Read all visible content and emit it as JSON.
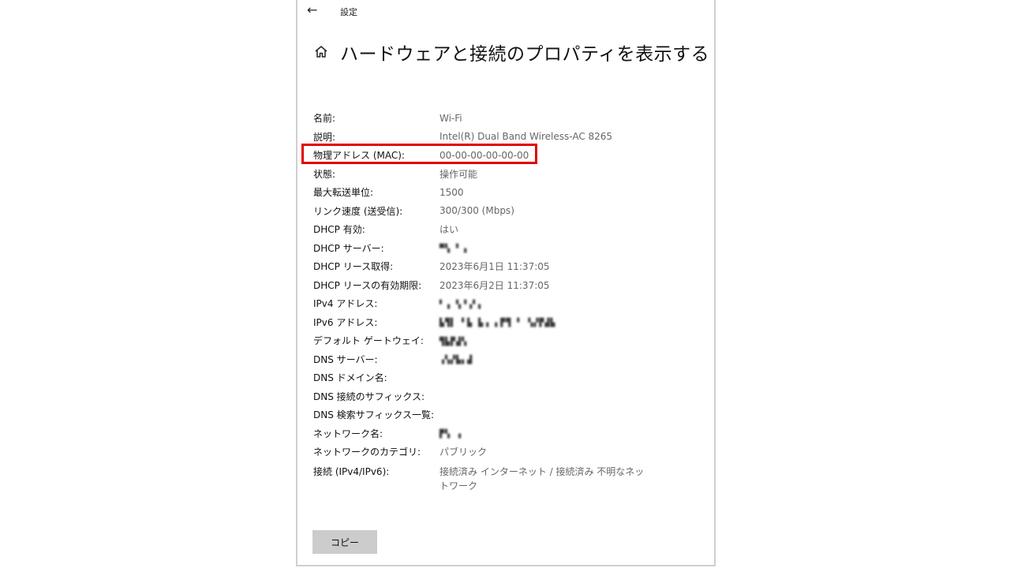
{
  "window": {
    "title": "設定"
  },
  "header": {
    "title": "ハードウェアと接続のプロパティを表示する"
  },
  "properties": [
    {
      "label": "名前:",
      "value": "Wi-Fi"
    },
    {
      "label": "説明:",
      "value": "Intel(R) Dual Band Wireless-AC 8265"
    },
    {
      "label": "物理アドレス (MAC):",
      "value": "00-00-00-00-00-00"
    },
    {
      "label": "状態:",
      "value": "操作可能"
    },
    {
      "label": "最大転送単位:",
      "value": "1500"
    },
    {
      "label": "リンク速度 (送受信):",
      "value": "300/300 (Mbps)"
    },
    {
      "label": "DHCP 有効:",
      "value": "はい"
    },
    {
      "label": "DHCP サーバー:",
      "value": ""
    },
    {
      "label": "DHCP リース取得:",
      "value": "2023年6月1日 11:37:05"
    },
    {
      "label": "DHCP リースの有効期限:",
      "value": "2023年6月2日 11:37:05"
    },
    {
      "label": "IPv4 アドレス:",
      "value": ""
    },
    {
      "label": "IPv6 アドレス:",
      "value": ""
    },
    {
      "label": "デフォルト ゲートウェイ:",
      "value": ""
    },
    {
      "label": "DNS サーバー:",
      "value": ""
    },
    {
      "label": "DNS ドメイン名:",
      "value": ""
    },
    {
      "label": "DNS 接続のサフィックス:",
      "value": ""
    },
    {
      "label": "DNS 検索サフィックス一覧:",
      "value": ""
    },
    {
      "label": "ネットワーク名:",
      "value": ""
    },
    {
      "label": "ネットワークのカテゴリ:",
      "value": "パブリック"
    },
    {
      "label": "接続 (IPv4/IPv6):",
      "value": "接続済み インターネット / 接続済み 不明なネットワーク"
    }
  ],
  "buttons": {
    "copy_label": "コピー"
  },
  "icons": {
    "back": "back-arrow-icon",
    "home": "home-icon"
  },
  "colors": {
    "highlight": "#e00000",
    "button_bg": "#cccccc"
  }
}
